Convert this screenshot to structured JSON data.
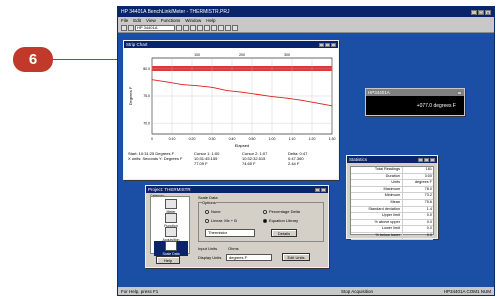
{
  "callout": {
    "number": "6"
  },
  "app": {
    "title": "HP 34401A BenchLink/Meter - THERMISTR.PRJ",
    "menu": [
      "File",
      "Edit",
      "View",
      "Functions",
      "Window",
      "Help"
    ],
    "toolbar_select": "HP 34401A",
    "status": {
      "left": "For Help, press F1",
      "mid": "Stop Acquisition",
      "right": "HP34401A  COM1  NUM"
    }
  },
  "strip_chart": {
    "title": "Strip Chart",
    "foot": [
      [
        "Start: 10:31:25  Degrees F",
        "X units: Seconds  Y: Degrees F"
      ],
      [
        "Cursor 1: 1:00",
        "10:31:45.155",
        "77.09 F"
      ],
      [
        "Cursor 2: 1:07",
        "10:32:32.515",
        "74.65 F"
      ],
      [
        "Delta: 0:47",
        "0:47.360",
        "2.44 F"
      ]
    ]
  },
  "chart_data": {
    "type": "line",
    "xlabel": "Elapsed",
    "ylabel": "Degrees F",
    "x_ticks": [
      "0",
      "0:10",
      "0:20",
      "0:30",
      "0:40",
      "0:50",
      "1:00",
      "1:10",
      "1:20",
      "1:30"
    ],
    "top_ticks": [
      "100",
      "200",
      "300"
    ],
    "y_ticks": [
      "80.0",
      "75.0",
      "70.0"
    ],
    "ylim": [
      68,
      82
    ],
    "series": [
      {
        "values": [
          78.0,
          77.6,
          77.1,
          76.9,
          76.6,
          76.0,
          75.7,
          75.3,
          74.9,
          74.6,
          74.2,
          73.7,
          73.2
        ]
      }
    ]
  },
  "meter": {
    "title": "HP34401A",
    "reading": "+077.0 degrees F"
  },
  "statistics": {
    "title": "Statistics",
    "rows": [
      [
        "Total Readings",
        "181"
      ],
      [
        "Duration",
        "3:00"
      ],
      [
        "Units",
        "degrees F"
      ],
      [
        "Maximum",
        "78.0"
      ],
      [
        "Minimum",
        "73.2"
      ],
      [
        "Mean",
        "75.6"
      ],
      [
        "Standard deviation",
        "1.4"
      ],
      [
        "Upper limit",
        "0.0"
      ],
      [
        "% above upper",
        "0.0"
      ],
      [
        "Lower limit",
        "0.0"
      ],
      [
        "% below lower",
        "0.0"
      ]
    ]
  },
  "project": {
    "title": "Project: THERMISTR",
    "category_label": "Category",
    "categories": [
      "Meter",
      "Function",
      "Acquisition",
      "Scale Data"
    ],
    "scale_label": "Scale Data",
    "options_label": "Options",
    "radios": [
      "None",
      "Linear: Mx + B",
      "Percentage Delta",
      "Equation Library"
    ],
    "equation_value": "Thermistor",
    "details_btn": "Details",
    "input_units_label": "Input Units",
    "input_units_value": "Ohms",
    "display_units_label": "Display Units",
    "display_units_value": "degrees F",
    "edit_units_btn": "Edit Units",
    "help_btn": "Help"
  },
  "colors": {
    "desktop": "#1b4fa6",
    "titlebar": "#0a246a",
    "trace": "#e02020",
    "callout": "#c0392b"
  }
}
